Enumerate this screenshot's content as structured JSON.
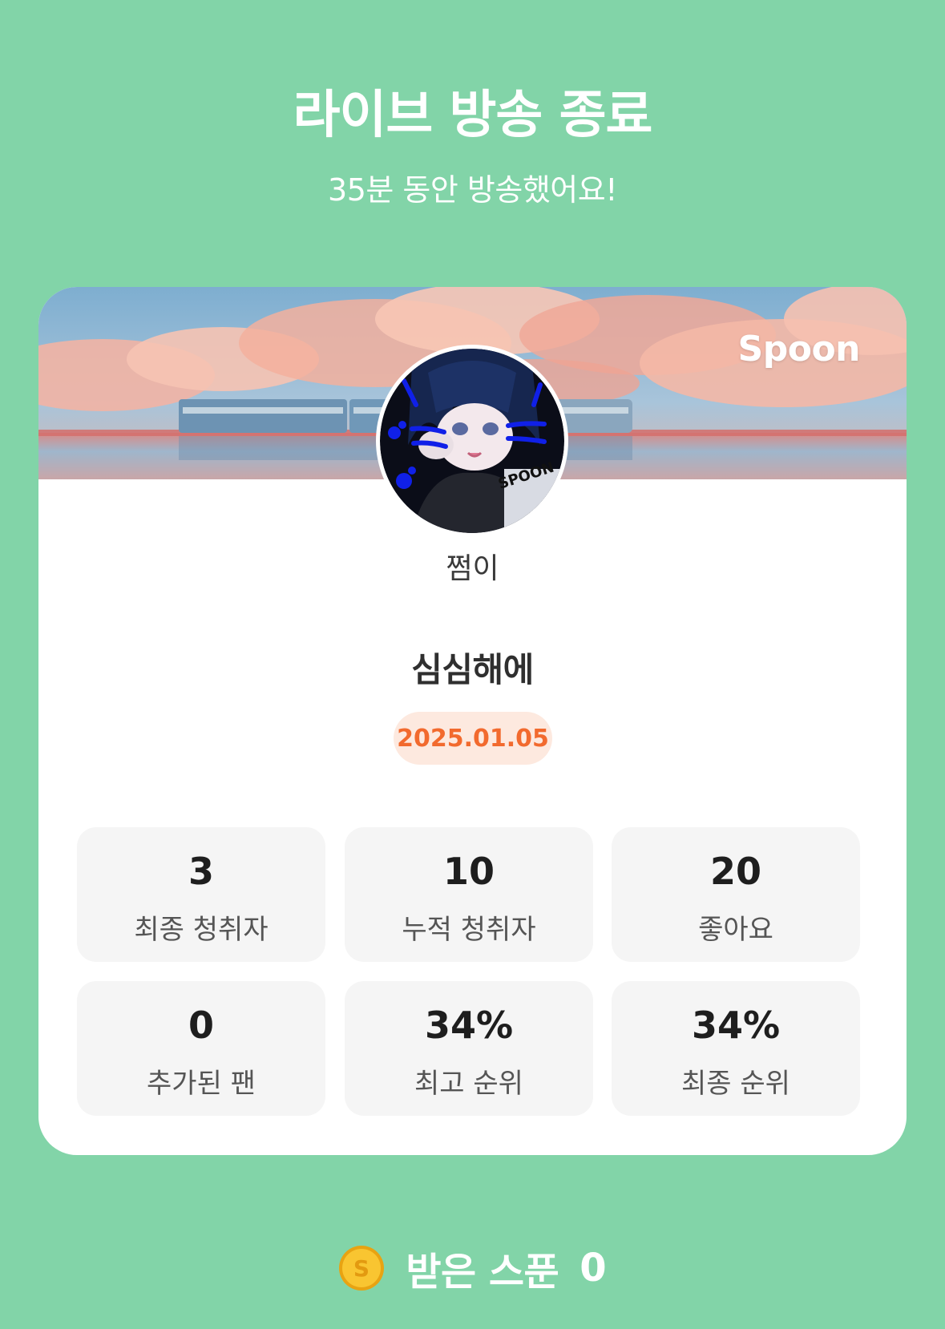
{
  "header": {
    "title": "라이브 방송 종료",
    "subtitle": "35분 동안 방송했어요!"
  },
  "card": {
    "brand": "Spoon",
    "nickname": "쩜이",
    "live_title": "심심해에",
    "date": "2025.01.05",
    "stats": [
      {
        "value": "3",
        "label": "최종 청취자"
      },
      {
        "value": "10",
        "label": "누적 청취자"
      },
      {
        "value": "20",
        "label": "좋아요"
      },
      {
        "value": "0",
        "label": "추가된 팬"
      },
      {
        "value": "34%",
        "label": "최고 순위"
      },
      {
        "value": "34%",
        "label": "최종 순위"
      }
    ]
  },
  "footer": {
    "coin_letter": "S",
    "spoons_label": "받은 스푼",
    "spoons_value": "0"
  },
  "colors": {
    "background": "#82d4a8",
    "card": "#ffffff",
    "stat_box": "#f5f5f5",
    "date_text": "#f26a2e",
    "date_badge": "#fde9df",
    "coin": "#f5b81c"
  },
  "icons": {
    "coin": "spoon-coin-icon",
    "avatar": "profile-avatar"
  }
}
